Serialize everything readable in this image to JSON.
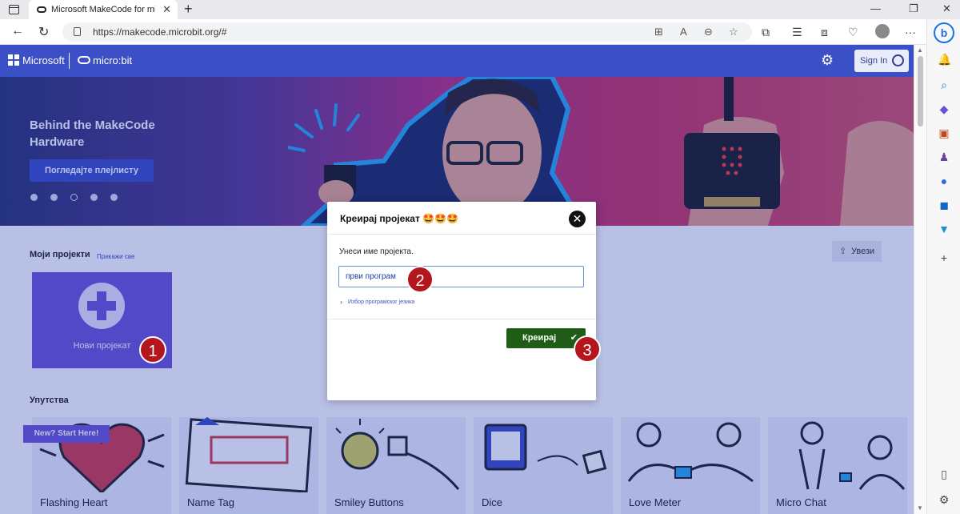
{
  "browser": {
    "tab_title": "Microsoft MakeCode for micro:bit",
    "tab_close": "✕",
    "new_tab": "+",
    "window_controls": [
      "—",
      "❐",
      "✕"
    ],
    "url": "https://makecode.microbit.org/#"
  },
  "header": {
    "ms_text": "Microsoft",
    "mb_text": "micro:bit",
    "signin_label": "Sign In"
  },
  "hero": {
    "title": "Behind the MakeCode Hardware",
    "button_label": "Погледајте плејлисту",
    "active_dot_index": 2
  },
  "projects": {
    "section_title": "Моји пројекти",
    "show_all": "Прикажи све",
    "import_label": "Увези",
    "new_project_label": "Нови пројекат"
  },
  "tutorials": {
    "section_title": "Упутства",
    "start_banner": "New? Start Here!",
    "cards": [
      {
        "label": "Flashing Heart"
      },
      {
        "label": "Name Tag"
      },
      {
        "label": "Smiley Buttons"
      },
      {
        "label": "Dice"
      },
      {
        "label": "Love Meter"
      },
      {
        "label": "Micro Chat"
      }
    ]
  },
  "modal": {
    "title": "Креирај пројекат 🤩🤩🤩",
    "close_label": "✕",
    "field_label": "Унеси име пројекта.",
    "input_value": "први програм",
    "lang_link": "Избор програмског језика",
    "create_label": "Креирај"
  },
  "steps": [
    "1",
    "2",
    "3"
  ],
  "colors": {
    "makecode_blue": "#3b50c6",
    "new_project_purple": "#6a55d6",
    "create_green": "#1f5c15",
    "step_red": "#b3161c"
  }
}
